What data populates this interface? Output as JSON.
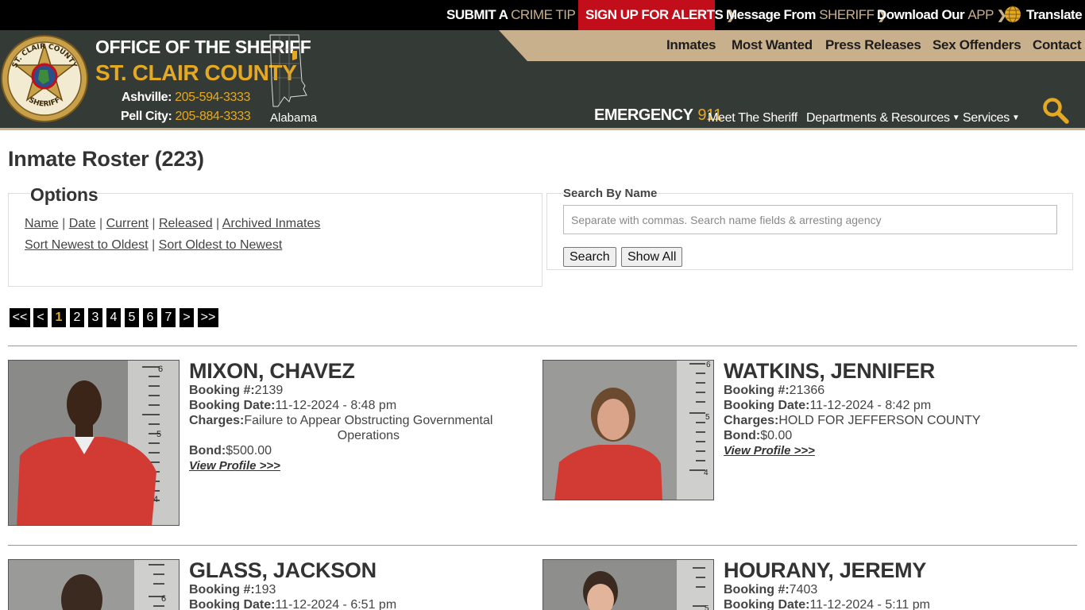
{
  "topbar": {
    "crime_tip": {
      "part1": "SUBMIT A",
      "part2": "CRIME TIP"
    },
    "alerts": "SIGN UP FOR ALERTS",
    "message": {
      "part1": "Message From",
      "part2": "SHERIFF"
    },
    "app": {
      "part1": "Download Our",
      "part2": "APP"
    },
    "translate": "Translate"
  },
  "header": {
    "title_line1": "OFFICE OF THE SHERIFF",
    "title_line2": "ST. CLAIR COUNTY",
    "phone1_label": "Ashville:",
    "phone1_number": "205-594-3333",
    "phone2_label": "Pell City:",
    "phone2_number": "205-884-3333",
    "state_label": "Alabama",
    "emergency_label": "EMERGENCY",
    "emergency_number": "911",
    "seal_text_top": "ST. CLAIR COUNTY",
    "seal_text_bottom": "SHERIFF"
  },
  "primary_nav": [
    "Inmates",
    "Most Wanted",
    "Press Releases",
    "Sex Offenders",
    "Contact"
  ],
  "secondary_nav": {
    "meet": "Meet The Sheriff",
    "departments": "Departments & Resources",
    "services": "Services"
  },
  "page": {
    "title": "Inmate Roster (223)"
  },
  "options": {
    "legend": "Options",
    "filters": [
      "Name",
      "Date",
      "Current",
      "Released",
      "Archived Inmates"
    ],
    "sorts": [
      "Sort Newest to Oldest",
      "Sort Oldest to Newest"
    ]
  },
  "search": {
    "legend": "Search By Name",
    "placeholder": "Separate with commas. Search name fields & arresting agency",
    "search_button": "Search",
    "show_all_button": "Show All"
  },
  "pagination": {
    "first": "<<",
    "prev": "<",
    "pages": [
      "1",
      "2",
      "3",
      "4",
      "5",
      "6",
      "7"
    ],
    "current": "1",
    "next": ">",
    "last": ">>"
  },
  "labels": {
    "booking": "Booking #:",
    "booking_date": "Booking Date:",
    "charges": "Charges:",
    "bond": "Bond:",
    "view_profile": "View Profile >>>"
  },
  "inmates": [
    {
      "name": "MIXON, CHAVEZ",
      "booking": "2139",
      "date": "11-12-2024 - 8:48 pm",
      "charges_line1": "Failure to Appear Obstructing Governmental",
      "charges_line2": "Operations",
      "bond": "$500.00"
    },
    {
      "name": "WATKINS, JENNIFER",
      "booking": "21366",
      "date": "11-12-2024 - 8:42 pm",
      "charges_line1": "HOLD FOR JEFFERSON COUNTY",
      "charges_line2": "",
      "bond": "$0.00"
    },
    {
      "name": "GLASS, JACKSON",
      "booking": "193",
      "date": "11-12-2024 - 6:51 pm"
    },
    {
      "name": "HOURANY, JEREMY",
      "booking": "7403",
      "date": "11-12-2024 - 5:11 pm"
    }
  ],
  "mugshot_ruler": {
    "card1": [
      "6",
      "5",
      "4"
    ],
    "card2": [
      "6",
      "5",
      "4"
    ],
    "card3": [
      "6"
    ],
    "card4": [
      "5"
    ]
  },
  "colors": {
    "header_bg": "#343b36",
    "tan": "#c9b08c",
    "gold": "#e5a823",
    "alert_red": "#c20e1a"
  }
}
